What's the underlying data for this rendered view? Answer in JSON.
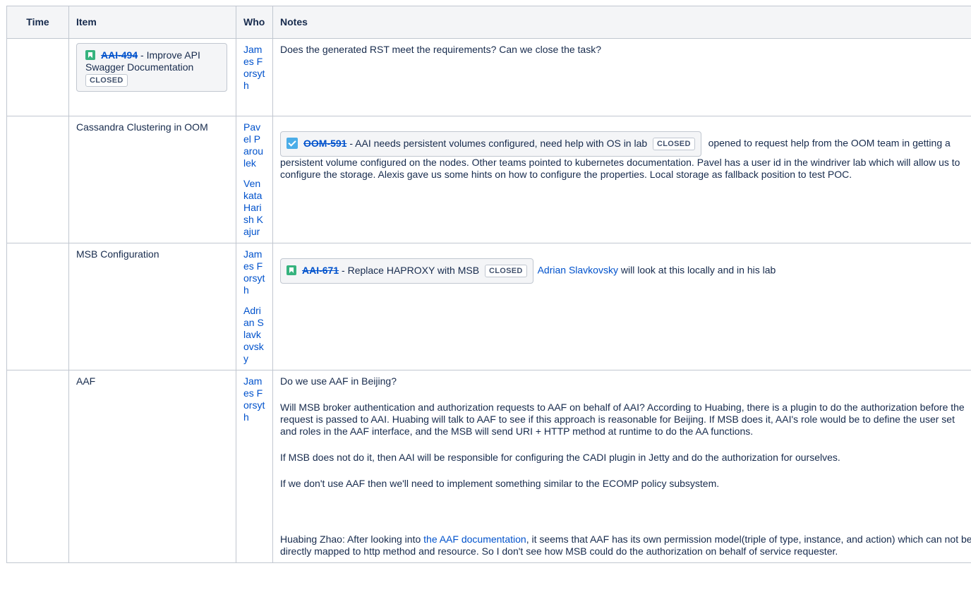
{
  "table": {
    "headers": {
      "time": "Time",
      "item": "Item",
      "who": "Who",
      "notes": "Notes"
    }
  },
  "rows": [
    {
      "item": {
        "jira": {
          "key": "AAI-494",
          "summary": " - Improve API Swagger Documentation",
          "status": "CLOSED",
          "icon": "story-icon"
        }
      },
      "who": [
        "James Forsyth"
      ],
      "notes": [
        "Does the generated RST meet the requirements? Can we close the task?"
      ]
    },
    {
      "item": {
        "text": "Cassandra Clustering in OOM"
      },
      "who": [
        "Pavel Paroulek",
        "Venkata Harish Kajur"
      ],
      "notes": {
        "jira": {
          "key": "OOM-591",
          "summary": " - AAI needs persistent volumes configured, need help with OS in lab",
          "status": "CLOSED",
          "icon": "task-icon"
        },
        "after": " opened to request help from the OOM team in getting a persistent volume configured on the nodes.  Other teams pointed to kubernetes documentation.  Pavel has a user id in the windriver lab which will allow us to configure the storage.  Alexis gave us some hints on how to configure the properties.  Local storage as fallback position to test POC."
      }
    },
    {
      "item": {
        "text": "MSB Configuration"
      },
      "who": [
        "James Forsyth",
        "Adrian Slavkovsky"
      ],
      "notes": {
        "jira": {
          "key": "AAI-671",
          "summary": " - Replace HAPROXY with MSB",
          "status": "CLOSED",
          "icon": "story-icon"
        },
        "mention": "Adrian Slavkovsky",
        "after": " will look at this locally and in his lab"
      }
    },
    {
      "item": {
        "text": "AAF"
      },
      "who": [
        "James Forsyth"
      ],
      "notes": [
        "Do we use AAF in Beijing?",
        "Will MSB broker authentication and authorization requests to AAF on behalf of AAI?  According to Huabing, there is a plugin to do the authorization before the request is passed to AAI.  Huabing will talk to AAF to see if this approach is reasonable for Beijing.  If MSB does it, AAI's role would be to define the user set and roles in the AAF interface, and the MSB will send URI + HTTP method at runtime to do the AA functions.",
        "If MSB does not do it, then AAI will be responsible for configuring the CADI plugin in Jetty and do the authorization for ourselves.",
        "If we don't use AAF then we'll need to implement something similar to the ECOMP policy subsystem."
      ],
      "huabing": {
        "before": "Huabing Zhao: After looking into ",
        "link": "the AAF documentation",
        "after": ", it seems that AAF has its own permission model(triple of type, instance, and action) which can not be directly mapped to http method and resource. So I don't see how MSB could do the authorization on behalf of service requester."
      }
    }
  ],
  "colors": {
    "link": "#0052cc",
    "header_bg": "#f4f5f7",
    "border": "#c1c7d0",
    "story": "#36b37e",
    "task": "#4bade8"
  }
}
